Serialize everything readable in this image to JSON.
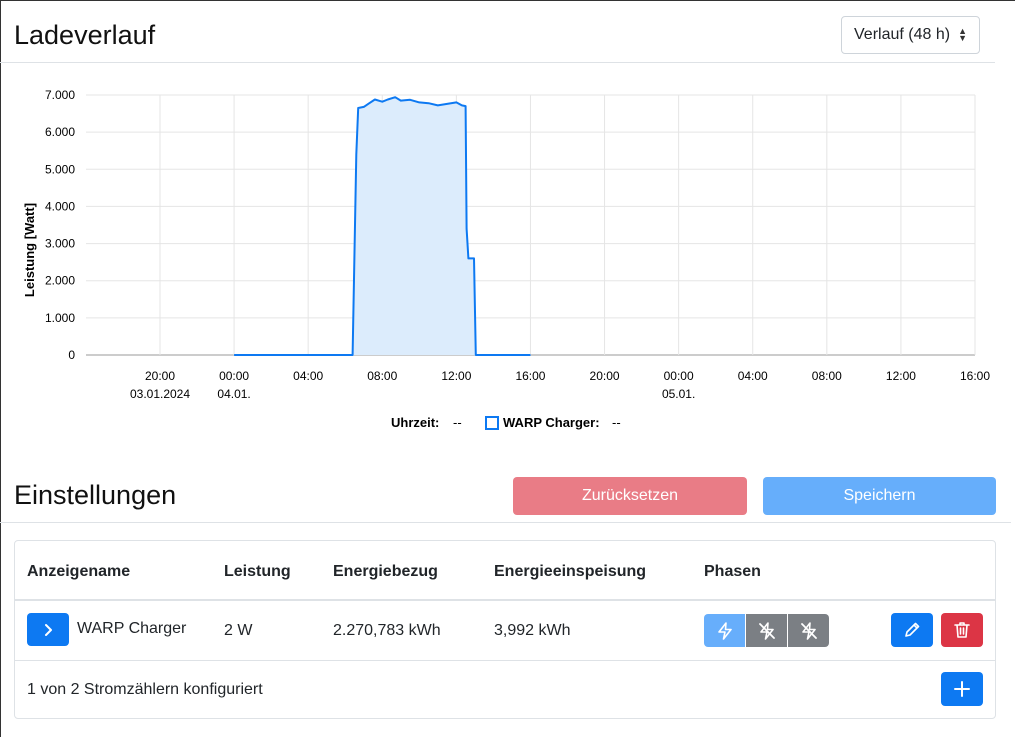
{
  "header": {
    "title": "Ladeverlauf"
  },
  "range_select": {
    "value": "Verlauf (48 h)"
  },
  "chart_data": {
    "type": "area",
    "ylabel": "Leistung [Watt]",
    "ylim": [
      0,
      7000
    ],
    "y_ticks": [
      "7.000",
      "6.000",
      "5.000",
      "4.000",
      "3.000",
      "2.000",
      "1.000",
      "0"
    ],
    "x_ticks": [
      {
        "time": "20:00",
        "date": "03.01.2024"
      },
      {
        "time": "00:00",
        "date": "04.01."
      },
      {
        "time": "04:00",
        "date": ""
      },
      {
        "time": "08:00",
        "date": ""
      },
      {
        "time": "12:00",
        "date": ""
      },
      {
        "time": "16:00",
        "date": ""
      },
      {
        "time": "20:00",
        "date": ""
      },
      {
        "time": "00:00",
        "date": "05.01."
      },
      {
        "time": "04:00",
        "date": ""
      },
      {
        "time": "08:00",
        "date": ""
      },
      {
        "time": "12:00",
        "date": ""
      },
      {
        "time": "16:00",
        "date": ""
      }
    ],
    "x_hours_range": [
      0,
      48
    ],
    "series": [
      {
        "name": "WARP Charger",
        "color": "#0d79f2",
        "fill": "#dcecfc",
        "x": [
          0,
          6.4,
          6.6,
          6.7,
          7.0,
          7.3,
          7.6,
          8.0,
          8.3,
          8.7,
          9.0,
          9.5,
          10.0,
          10.5,
          11.0,
          11.5,
          12.0,
          12.3,
          12.5,
          12.55,
          12.65,
          12.95,
          13.05,
          14.0,
          16.0
        ],
        "y": [
          0,
          0,
          5400,
          6650,
          6680,
          6780,
          6880,
          6820,
          6880,
          6940,
          6850,
          6870,
          6800,
          6780,
          6720,
          6760,
          6800,
          6720,
          6700,
          3400,
          2600,
          2600,
          0,
          0,
          0
        ]
      }
    ],
    "legend": {
      "time_label": "Uhrzeit:",
      "time_value": "--",
      "series_label": "WARP Charger:",
      "series_value": "--"
    }
  },
  "settings": {
    "title": "Einstellungen",
    "reset_label": "Zurücksetzen",
    "save_label": "Speichern"
  },
  "table": {
    "headers": [
      "Anzeigename",
      "Leistung",
      "Energiebezug",
      "Energieeinspeisung",
      "Phasen"
    ],
    "rows": [
      {
        "name": "WARP Charger",
        "power": "2 W",
        "import": "2.270,783 kWh",
        "export": "3,992 kWh"
      }
    ],
    "footer": "1 von 2 Stromzählern konfiguriert"
  },
  "colors": {
    "primary": "#0d79f2",
    "danger": "#dc3545"
  }
}
